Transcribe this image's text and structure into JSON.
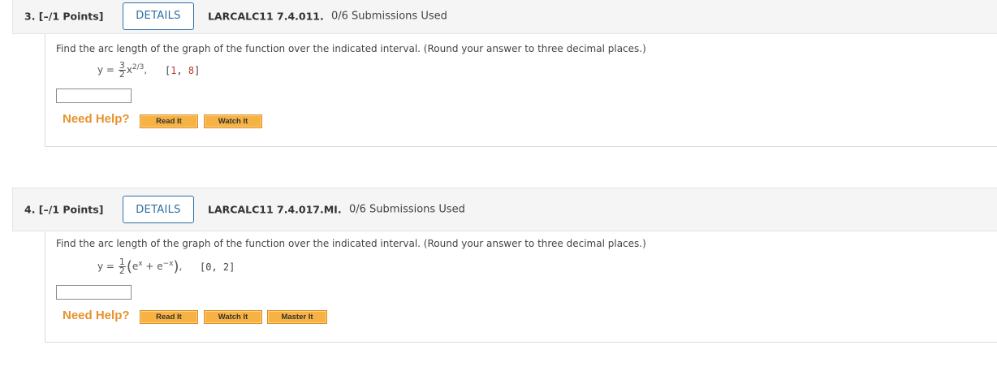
{
  "questions": [
    {
      "number_label": "3. [–/1 Points]",
      "details_label": "DETAILS",
      "code": "LARCALC11 7.4.011.",
      "submissions": "0/6 Submissions Used",
      "prompt": "Find the arc length of the graph of the function over the indicated interval. (Round your answer to three decimal places.)",
      "equation": {
        "lhs": "y =",
        "frac_num": "3",
        "frac_den": "2",
        "body": "x",
        "exponent": "2/3",
        "trail": ","
      },
      "interval": {
        "open": "[",
        "a": "1",
        "sep": ", ",
        "b": "8",
        "close": "]"
      },
      "answer_value": "",
      "need_help_label": "Need Help?",
      "help_buttons": [
        "Read It",
        "Watch It"
      ]
    },
    {
      "number_label": "4. [–/1 Points]",
      "details_label": "DETAILS",
      "code": "LARCALC11 7.4.017.MI.",
      "submissions": "0/6 Submissions Used",
      "prompt": "Find the arc length of the graph of the function over the indicated interval. (Round your answer to three decimal places.)",
      "equation": {
        "lhs": "y =",
        "frac_num": "1",
        "frac_den": "2",
        "open_paren": "(",
        "term1": "e",
        "exp1": "x",
        "plus": " + ",
        "term2": "e",
        "exp2": "−x",
        "close_paren": ")",
        "trail": ","
      },
      "interval": {
        "text": "[0, 2]"
      },
      "answer_value": "",
      "need_help_label": "Need Help?",
      "help_buttons": [
        "Read It",
        "Watch It",
        "Master It"
      ]
    }
  ],
  "colors": {
    "details_border": "#2e6fa7",
    "need_help": "#e7922c",
    "help_button_bg": "#f7b244",
    "interval_red": "#c0392b"
  }
}
